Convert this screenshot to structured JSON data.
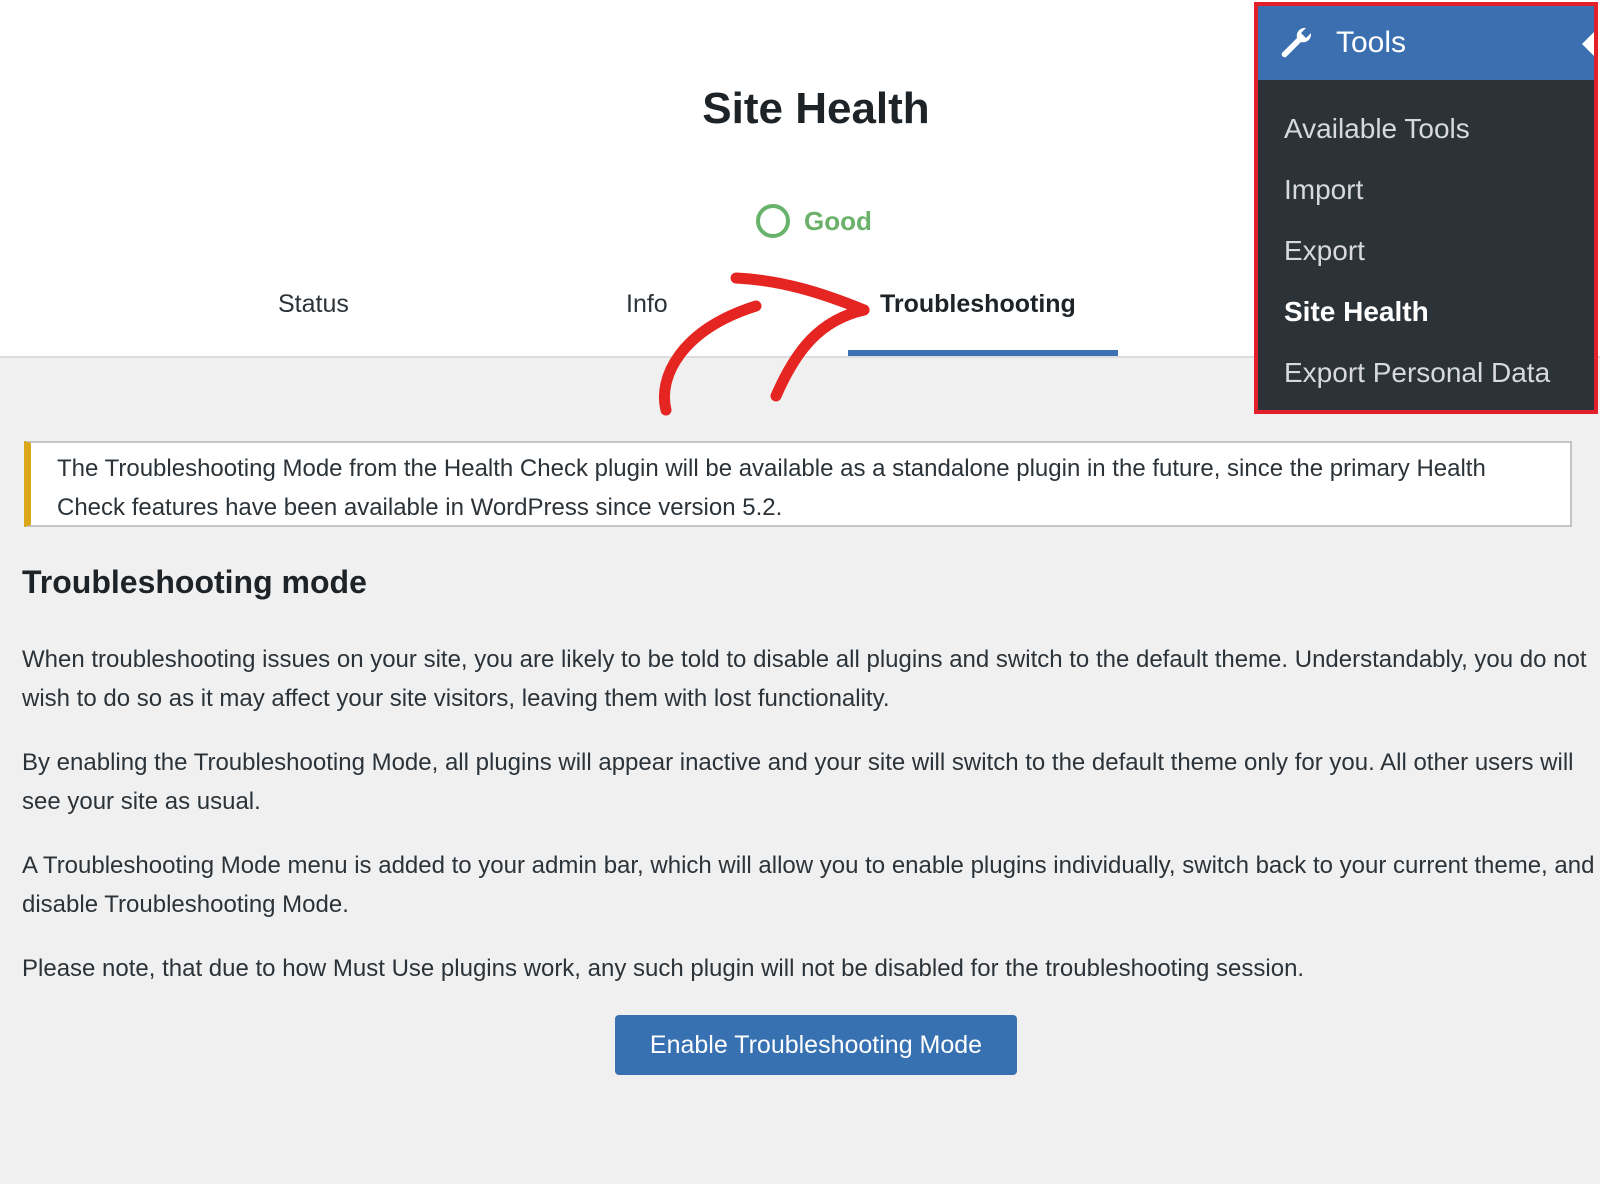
{
  "page": {
    "title": "Site Health"
  },
  "status": {
    "label": "Good",
    "color": "#68b36b"
  },
  "tabs": [
    {
      "label": "Status"
    },
    {
      "label": "Info"
    },
    {
      "label": "Troubleshooting",
      "active": true
    }
  ],
  "tools_menu": {
    "title": "Tools",
    "icon": "wrench-icon",
    "header_color": "#3b6fb0",
    "highlight_border_color": "#e2202a",
    "items": [
      {
        "label": "Available Tools"
      },
      {
        "label": "Import"
      },
      {
        "label": "Export"
      },
      {
        "label": "Site Health",
        "active": true
      },
      {
        "label": "Export Personal Data"
      }
    ]
  },
  "notice": {
    "text": "The Troubleshooting Mode from the Health Check plugin will be available as a standalone plugin in the future, since the primary Health Check features have been available in WordPress since version 5.2.",
    "accent_color": "#dba617"
  },
  "section": {
    "heading": "Troubleshooting mode",
    "paragraphs": [
      "When troubleshooting issues on your site, you are likely to be told to disable all plugins and switch to the default theme. Understandably, you do not wish to do so as it may affect your site visitors, leaving them with lost functionality.",
      "By enabling the Troubleshooting Mode, all plugins will appear inactive and your site will switch to the default theme only for you. All other users will see your site as usual.",
      "A Troubleshooting Mode menu is added to your admin bar, which will allow you to enable plugins individually, switch back to your current theme, and disable Troubleshooting Mode.",
      "Please note, that due to how Must Use plugins work, any such plugin will not be disabled for the troubleshooting session."
    ]
  },
  "button": {
    "label": "Enable Troubleshooting Mode",
    "color": "#3871b2"
  },
  "annotation": {
    "arrow_color": "#e52521"
  }
}
